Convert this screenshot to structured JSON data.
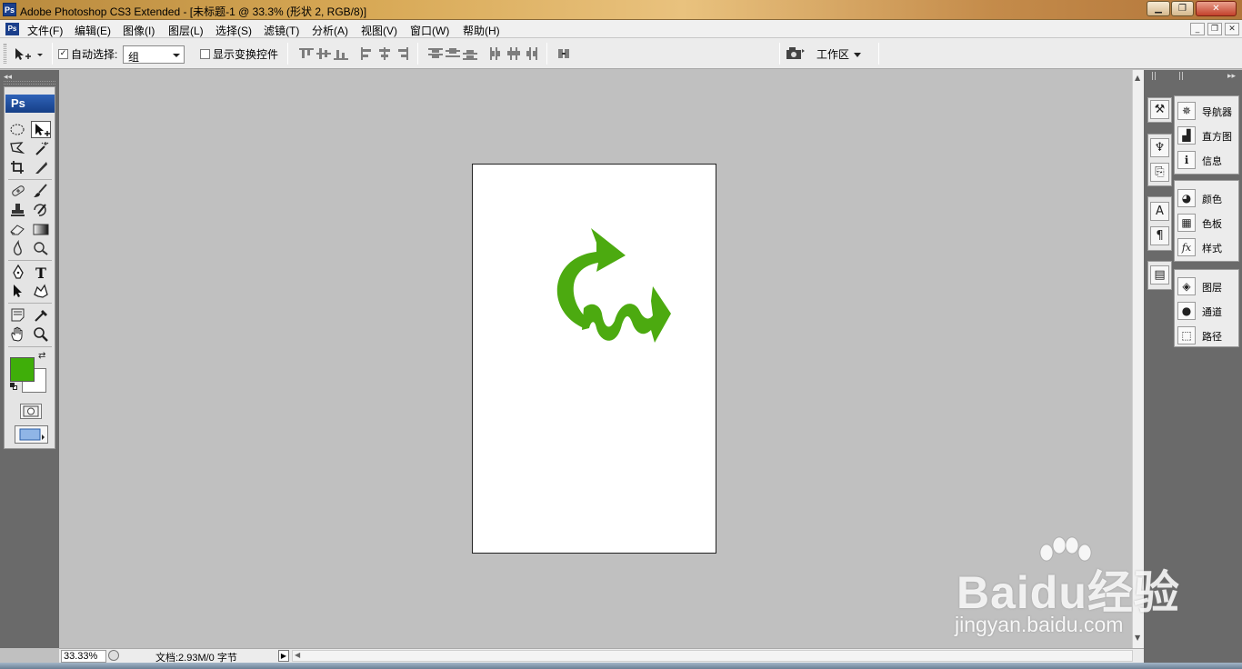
{
  "window": {
    "title": "Adobe Photoshop CS3 Extended - [未标题-1 @ 33.3% (形状 2, RGB/8)]",
    "app_badge": "Ps"
  },
  "menu": {
    "doc_badge": "Ps",
    "items": [
      "文件(F)",
      "编辑(E)",
      "图像(I)",
      "图层(L)",
      "选择(S)",
      "滤镜(T)",
      "分析(A)",
      "视图(V)",
      "窗口(W)",
      "帮助(H)"
    ]
  },
  "options": {
    "auto_select_checked": true,
    "auto_select_label": "自动选择:",
    "auto_select_value": "组",
    "show_transform_checked": false,
    "show_transform_label": "显示变换控件",
    "workspace_label": "工作区"
  },
  "toolbox": {
    "logo": "Ps",
    "foreground_color": "#3fae09",
    "background_color": "#ffffff",
    "tools": [
      [
        "marquee-ellipse-icon",
        "move-icon"
      ],
      [
        "lasso-polygon-icon",
        "magic-wand-icon"
      ],
      [
        "crop-icon",
        "slice-icon"
      ],
      [
        "healing-brush-icon",
        "brush-icon"
      ],
      [
        "clone-stamp-icon",
        "history-brush-icon"
      ],
      [
        "eraser-icon",
        "gradient-icon"
      ],
      [
        "blur-icon",
        "dodge-icon"
      ],
      [
        "pen-icon",
        "type-icon"
      ],
      [
        "path-selection-icon",
        "custom-shape-icon"
      ],
      [
        "notes-icon",
        "eyedropper-icon"
      ],
      [
        "hand-icon",
        "zoom-icon"
      ]
    ]
  },
  "document": {
    "shape_color": "#4caa10"
  },
  "status": {
    "zoom": "33.33%",
    "doc_info": "文档:2.93M/0 字节"
  },
  "panels": {
    "groups": [
      [
        "导航器",
        "直方图",
        "信息"
      ],
      [
        "颜色",
        "色板",
        "样式"
      ],
      [
        "图层",
        "通道",
        "路径"
      ]
    ]
  },
  "watermark": {
    "brand": "Baidu经验",
    "url": "jingyan.baidu.com"
  }
}
